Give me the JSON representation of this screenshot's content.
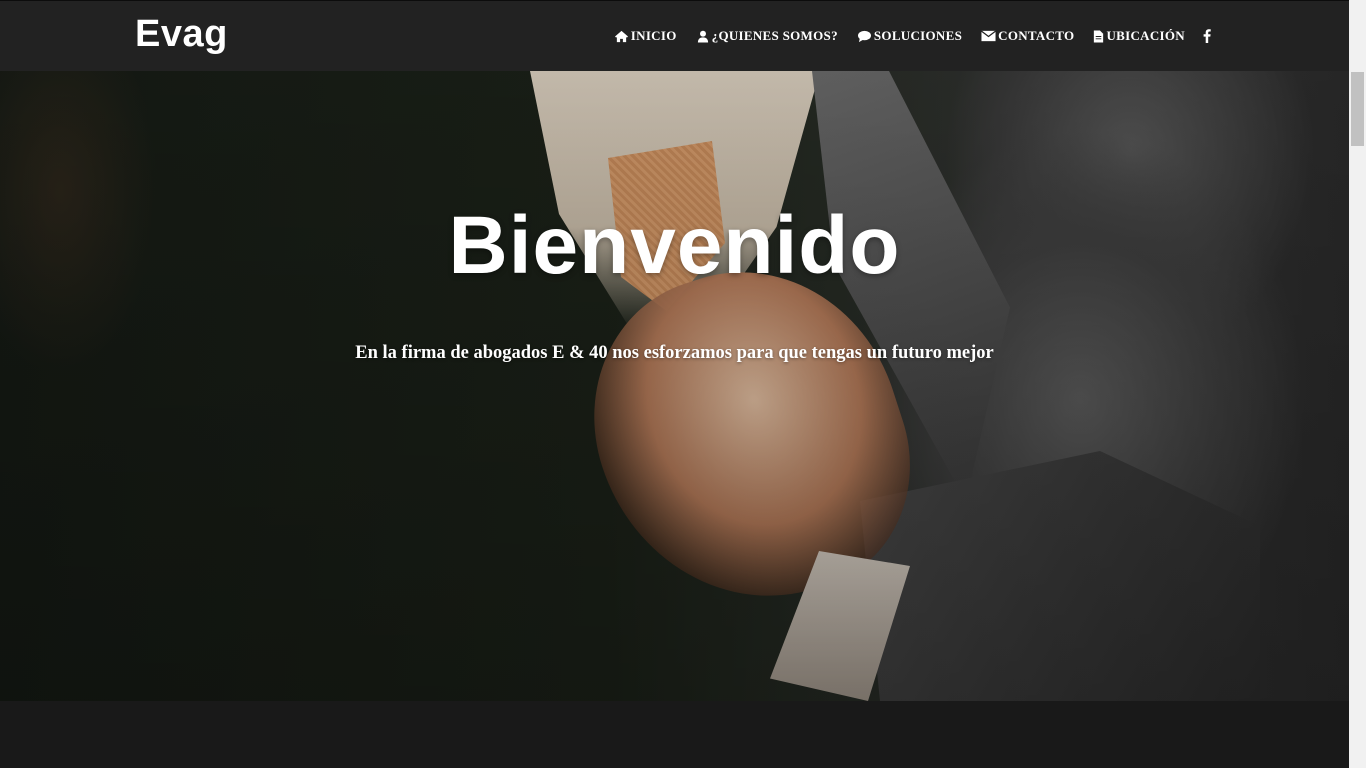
{
  "brand": "Evag",
  "nav": {
    "items": [
      {
        "label": "INICIO",
        "icon": "home-icon"
      },
      {
        "label": "¿QUIENES SOMOS?",
        "icon": "user-icon"
      },
      {
        "label": "SOLUCIONES",
        "icon": "comment-icon"
      },
      {
        "label": "CONTACTO",
        "icon": "envelope-icon"
      },
      {
        "label": "UBICACIÓN",
        "icon": "document-icon"
      }
    ],
    "social": {
      "icon": "facebook-icon"
    }
  },
  "hero": {
    "title": "Bienvenido",
    "subtitle": "En la firma de abogados E & 40 nos esforzamos para que tengas un futuro mejor"
  },
  "colors": {
    "navbar_bg": "#222222",
    "text": "#ffffff",
    "footer_bg": "#191919"
  }
}
